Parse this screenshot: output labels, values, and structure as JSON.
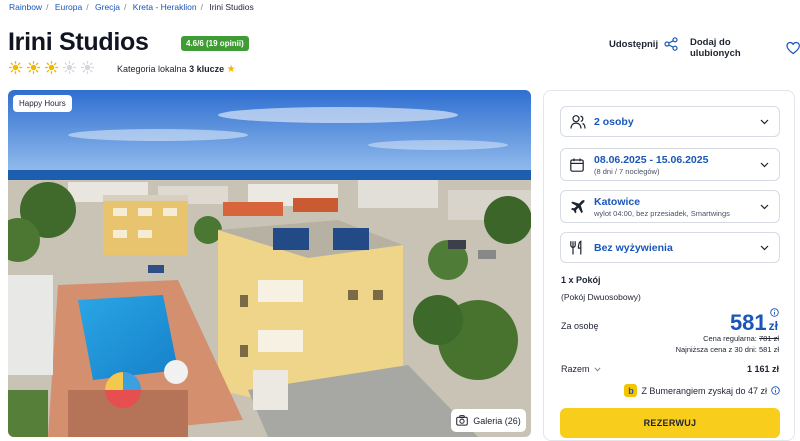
{
  "breadcrumb": [
    "Rainbow",
    "Europa",
    "Grecja",
    "Kreta - Heraklion",
    "Irini Studios"
  ],
  "hotel": {
    "name": "Irini Studios",
    "rating": "4.6/6 (19 opinii)",
    "stars_total": 5,
    "stars_filled": 3,
    "category_prefix": "Kategoria lokalna",
    "category_value": "3 klucze"
  },
  "actions": {
    "share": "Udostępnij",
    "favorite": "Dodaj do ulubionych"
  },
  "photo": {
    "badge": "Happy Hours",
    "gallery": "Galeria (26)"
  },
  "booking": {
    "persons": "2 osoby",
    "dates": "08.06.2025 - 15.06.2025",
    "dates_sub": "(8 dni / 7 noclegów)",
    "departure": "Katowice",
    "departure_sub": "wylot 04:00, bez przesiadek, Smartwings",
    "board": "Bez wyżywienia",
    "room": "1 x Pokój",
    "room_type": "(Pokój Dwuosobowy)",
    "per_person_label": "Za osobę",
    "price": "581",
    "currency": "zł",
    "regular_label": "Cena regularna:",
    "regular_value": "781 zł",
    "lowest_label": "Najniższa cena z 30 dni: 581 zł",
    "total_label": "Razem",
    "total_value": "1 161 zł",
    "bumerang": "Z Bumerangiem zyskaj do 47 zł",
    "reserve": "REZERWUJ"
  },
  "colors": {
    "accent": "#1a56b8",
    "rating": "#3f9c35",
    "cta": "#f8cd1b",
    "star": "#f2b705"
  }
}
